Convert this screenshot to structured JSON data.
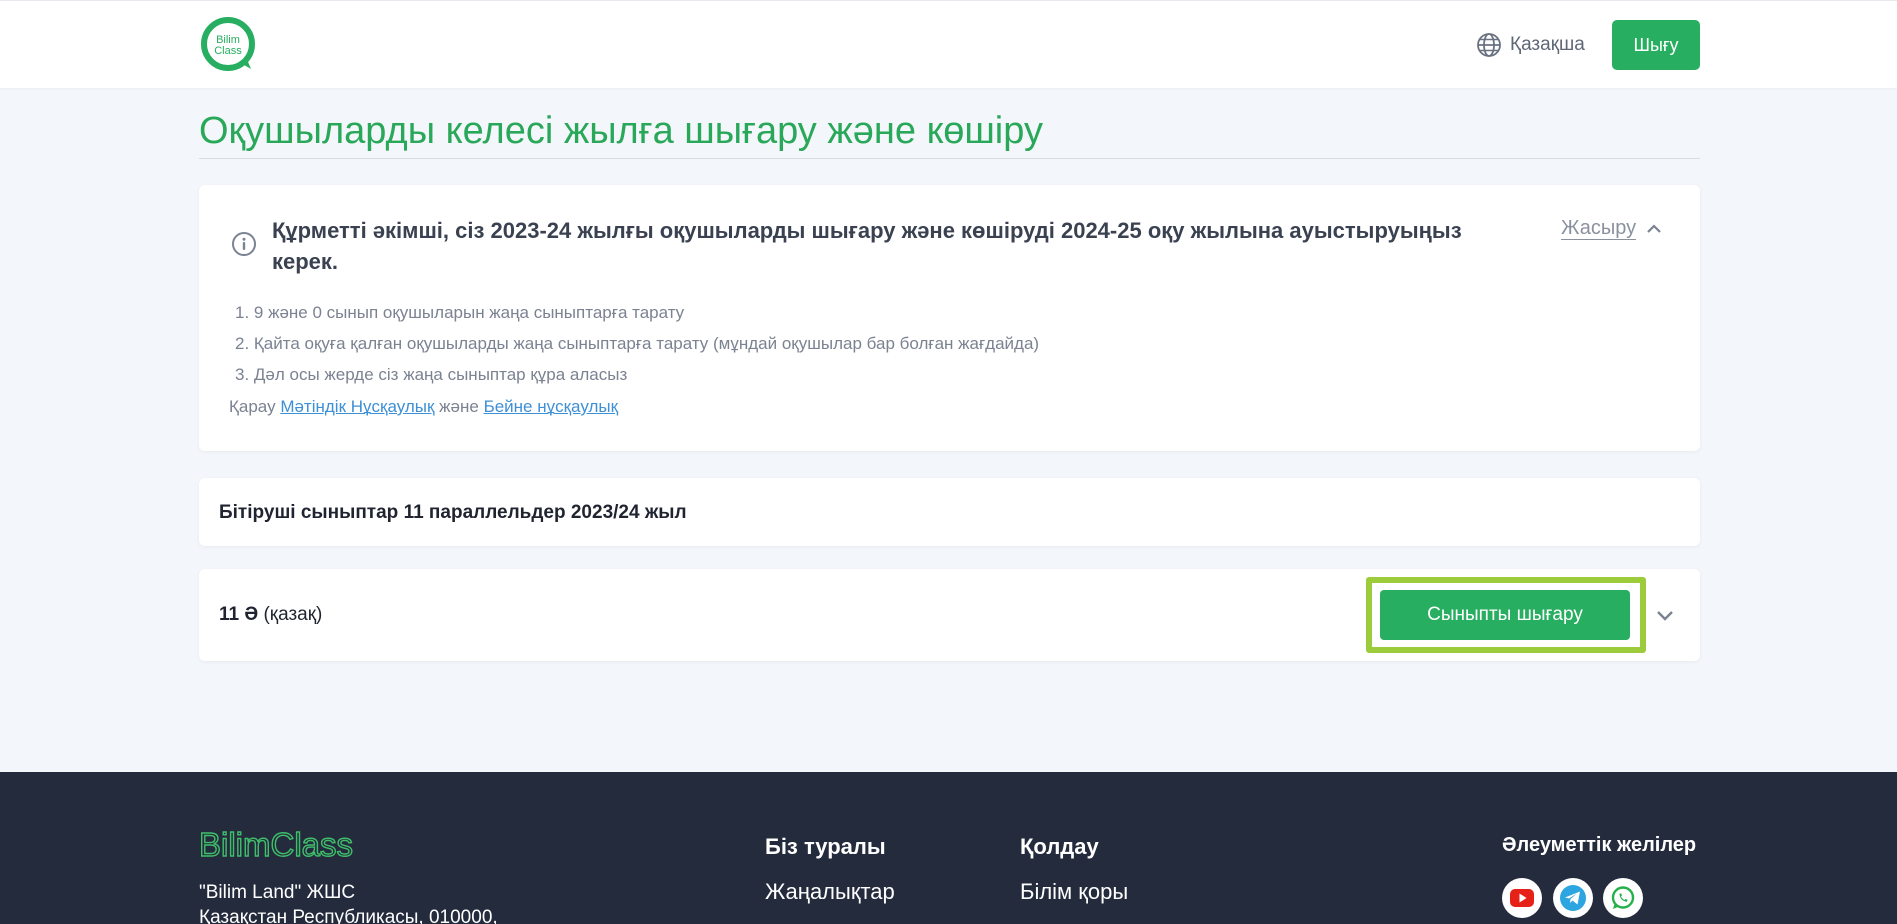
{
  "header": {
    "logo_text_top": "Bilim",
    "logo_text_bottom": "Class",
    "language": "Қазақша",
    "exit_label": "Шығу"
  },
  "page": {
    "title": "Оқушыларды келесі жылға шығару және көшіру"
  },
  "info": {
    "heading": "Құрметті әкімші, сіз 2023-24 жылғы оқушыларды шығару және көшіруді 2024-25 оқу жылына ауыстыруыңыз керек.",
    "hide_label": "Жасыру",
    "steps": [
      "1. 9 және 0 сынып оқушыларын жаңа сыныптарға тарату",
      "2. Қайта оқуға қалған оқушыларды жаңа сыныптарға тарату (мұндай оқушылар бар болған жағдайда)",
      "3. Дәл осы жерде сіз жаңа сыныптар құра аласыз"
    ],
    "see_prefix": "Қарау",
    "text_guide_link": "Мәтіндік Нұсқаулық",
    "and_word": "және",
    "video_guide_link": "Бейне нұсқаулық"
  },
  "graduating": {
    "title": "Бітіруші сыныптар 11 параллельдер 2023/24 жыл"
  },
  "class_item": {
    "name": "11 Ә",
    "language": "(қазақ)",
    "release_label": "Сыныпты шығару"
  },
  "footer": {
    "brand": "BilimClass",
    "company_name": "\"Bilim Land\" ЖШС",
    "company_address": "Қазақстан Республикасы, 010000,",
    "about_title": "Біз туралы",
    "about_link": "Жаңалықтар",
    "support_title": "Қолдау",
    "support_link": "Білім қоры",
    "social_title": "Әлеуметтік желілер",
    "social_icons": [
      "youtube-icon",
      "telegram-icon",
      "whatsapp-icon"
    ]
  },
  "colors": {
    "brand_green": "#27ae60",
    "title_green": "#2aa85a",
    "highlight": "#9ccb3b",
    "link_blue": "#3d8fd6",
    "footer_bg": "#242b3d"
  }
}
